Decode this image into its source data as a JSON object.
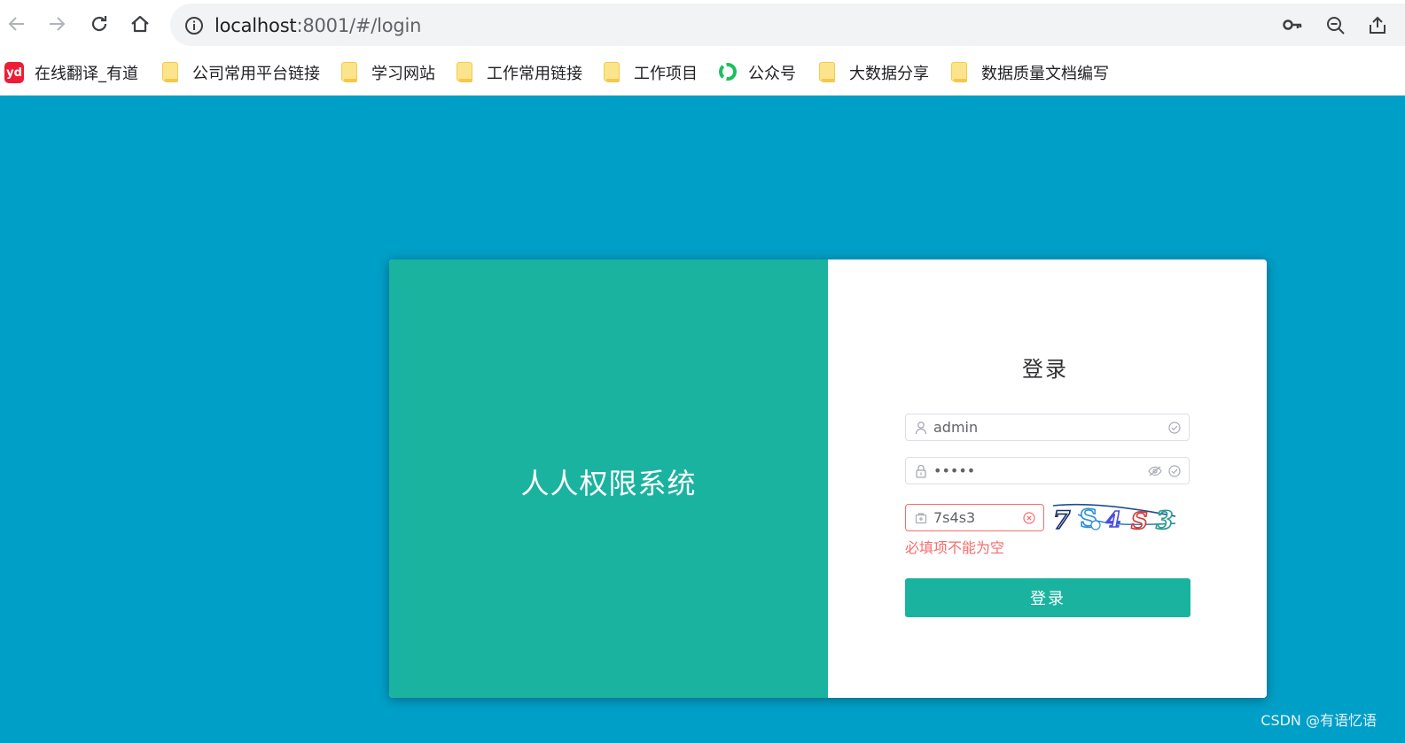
{
  "browser": {
    "url_host": "localhost",
    "url_rest": ":8001/#/login",
    "icons": [
      "back-icon",
      "forward-icon",
      "reload-icon",
      "home-icon",
      "info-icon",
      "key-icon",
      "zoom-out-icon",
      "share-icon"
    ],
    "bookmarks": [
      {
        "label": "在线翻译_有道",
        "icon": "youdao-icon",
        "yd_text": "yd"
      },
      {
        "label": "公司常用平台链接",
        "icon": "folder-icon"
      },
      {
        "label": "学习网站",
        "icon": "folder-icon"
      },
      {
        "label": "工作常用链接",
        "icon": "folder-icon"
      },
      {
        "label": "工作项目",
        "icon": "folder-icon"
      },
      {
        "label": "公众号",
        "icon": "wechat-mp-icon"
      },
      {
        "label": "大数据分享",
        "icon": "folder-icon"
      },
      {
        "label": "数据质量文档编写",
        "icon": "folder-icon"
      }
    ]
  },
  "page": {
    "system_title": "人人权限系统",
    "login_title": "登录",
    "username": {
      "value": "admin",
      "icon": "user-icon"
    },
    "password": {
      "value": "•••••",
      "icon": "lock-icon"
    },
    "captcha": {
      "value": "7s4s3",
      "icon": "captcha-icon",
      "image_text": "7S4S3",
      "error": "必填项不能为空"
    },
    "login_button": "登录",
    "colors": {
      "background": "#009fc7",
      "accent": "#1ab3a0",
      "error": "#f56c6c"
    }
  },
  "watermark": "CSDN @有语忆语"
}
